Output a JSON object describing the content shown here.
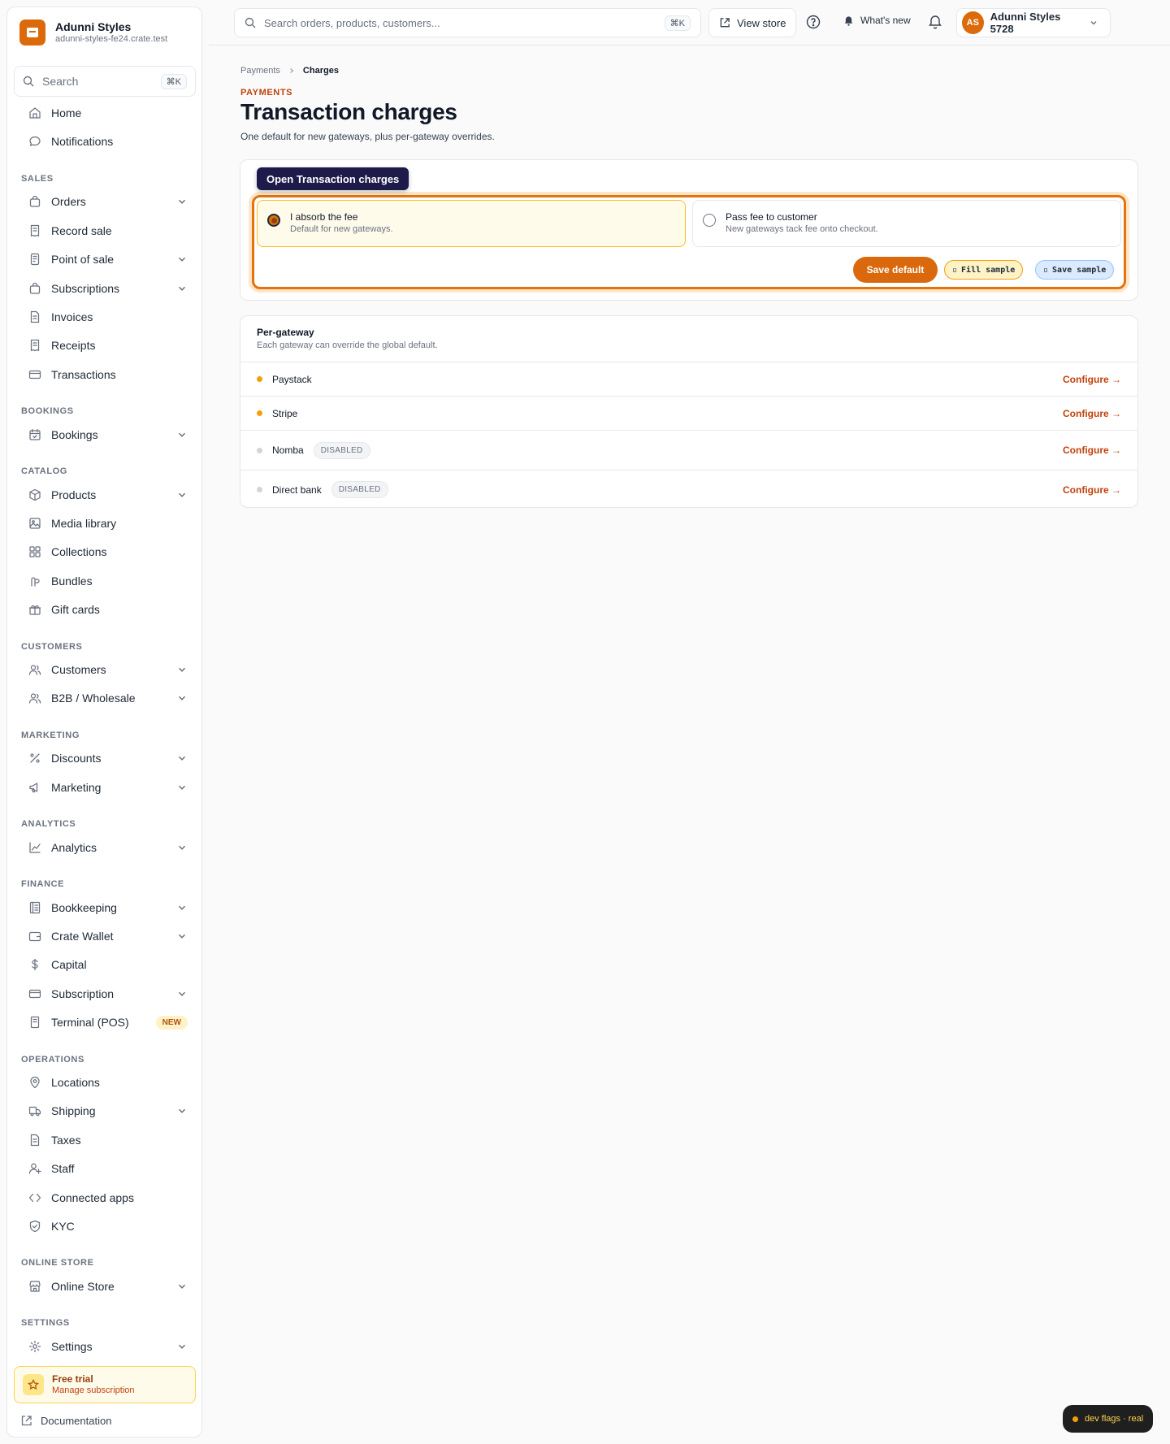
{
  "brand": {
    "name": "Adunni Styles",
    "domain": "adunni-styles-fe24.crate.test"
  },
  "sidebar": {
    "search_label": "Search",
    "search_kbd": "⌘K",
    "items": [
      {
        "label": "Home",
        "icon": "home-icon"
      },
      {
        "label": "Notifications",
        "icon": "chat-bubble-icon"
      },
      {
        "section": "SALES"
      },
      {
        "label": "Orders",
        "icon": "bag-icon",
        "chevron": true
      },
      {
        "label": "Record sale",
        "icon": "receipt-icon"
      },
      {
        "label": "Point of sale",
        "icon": "pos-icon",
        "chevron": true
      },
      {
        "label": "Subscriptions",
        "icon": "bag-icon",
        "chevron": true
      },
      {
        "label": "Invoices",
        "icon": "document-icon"
      },
      {
        "label": "Receipts",
        "icon": "receipt-icon"
      },
      {
        "label": "Transactions",
        "icon": "card-icon"
      },
      {
        "section": "BOOKINGS"
      },
      {
        "label": "Bookings",
        "icon": "calendar-icon",
        "chevron": true
      },
      {
        "section": "CATALOG"
      },
      {
        "label": "Products",
        "icon": "box-icon",
        "chevron": true
      },
      {
        "label": "Media library",
        "icon": "image-icon"
      },
      {
        "label": "Collections",
        "icon": "grid-icon"
      },
      {
        "label": "Bundles",
        "icon": "bundle-icon"
      },
      {
        "label": "Gift cards",
        "icon": "gift-icon"
      },
      {
        "section": "CUSTOMERS"
      },
      {
        "label": "Customers",
        "icon": "users-icon",
        "chevron": true
      },
      {
        "label": "B2B / Wholesale",
        "icon": "users-icon",
        "chevron": true
      },
      {
        "section": "MARKETING"
      },
      {
        "label": "Discounts",
        "icon": "discount-icon",
        "chevron": true
      },
      {
        "label": "Marketing",
        "icon": "megaphone-icon",
        "chevron": true
      },
      {
        "section": "ANALYTICS"
      },
      {
        "label": "Analytics",
        "icon": "chart-icon",
        "chevron": true
      },
      {
        "section": "FINANCE"
      },
      {
        "label": "Bookkeeping",
        "icon": "ledger-icon",
        "chevron": true
      },
      {
        "label": "Crate Wallet",
        "icon": "wallet-icon",
        "chevron": true
      },
      {
        "label": "Capital",
        "icon": "dollar-icon"
      },
      {
        "label": "Subscription",
        "icon": "card-icon",
        "chevron": true
      },
      {
        "label": "Terminal (POS)",
        "icon": "terminal-icon",
        "badge": "NEW"
      },
      {
        "section": "OPERATIONS"
      },
      {
        "label": "Locations",
        "icon": "pin-icon"
      },
      {
        "label": "Shipping",
        "icon": "truck-icon",
        "chevron": true
      },
      {
        "label": "Taxes",
        "icon": "document-icon"
      },
      {
        "label": "Staff",
        "icon": "user-plus-icon"
      },
      {
        "label": "Connected apps",
        "icon": "code-icon"
      },
      {
        "label": "KYC",
        "icon": "shield-icon"
      },
      {
        "section": "ONLINE STORE"
      },
      {
        "label": "Online Store",
        "icon": "store-icon",
        "chevron": true
      },
      {
        "section": "SETTINGS"
      },
      {
        "label": "Settings",
        "icon": "gear-icon",
        "chevron": true
      }
    ],
    "trial": {
      "title": "Free trial",
      "subtitle": "Manage subscription"
    },
    "documentation": "Documentation"
  },
  "topbar": {
    "search_placeholder": "Search orders, products, customers...",
    "search_kbd": "⌘K",
    "view_store": "View store",
    "whats_new": "What's new",
    "account": {
      "initials": "AS",
      "name": "Adunni Styles 5728"
    }
  },
  "page": {
    "breadcrumb": [
      "Payments",
      "Charges"
    ],
    "eyebrow": "PAYMENTS",
    "title": "Transaction charges",
    "subtitle": "One default for new gateways, plus per-gateway overrides.",
    "tooltip": "Open Transaction charges",
    "options": [
      {
        "title": "I absorb the fee",
        "subtitle": "Default for new gateways.",
        "selected": true
      },
      {
        "title": "Pass fee to customer",
        "subtitle": "New gateways tack fee onto checkout.",
        "selected": false
      }
    ],
    "save_default": "Save default",
    "fill_sample": "Fill sample",
    "save_sample": "Save sample",
    "per_gateway": {
      "title": "Per-gateway",
      "subtitle": "Each gateway can override the global default.",
      "configure_label": "Configure →",
      "rows": [
        {
          "name": "Paystack",
          "status_color": "#f59e0b",
          "badge": ""
        },
        {
          "name": "Stripe",
          "status_color": "#f59e0b",
          "badge": ""
        },
        {
          "name": "Nomba",
          "status_color": "#d1d5db",
          "badge": "DISABLED"
        },
        {
          "name": "Direct bank",
          "status_color": "#d1d5db",
          "badge": "DISABLED"
        }
      ]
    }
  },
  "dev_flags": "dev flags · real",
  "colors": {
    "accent": "#d9690c",
    "brand": "#dc6a0a"
  }
}
